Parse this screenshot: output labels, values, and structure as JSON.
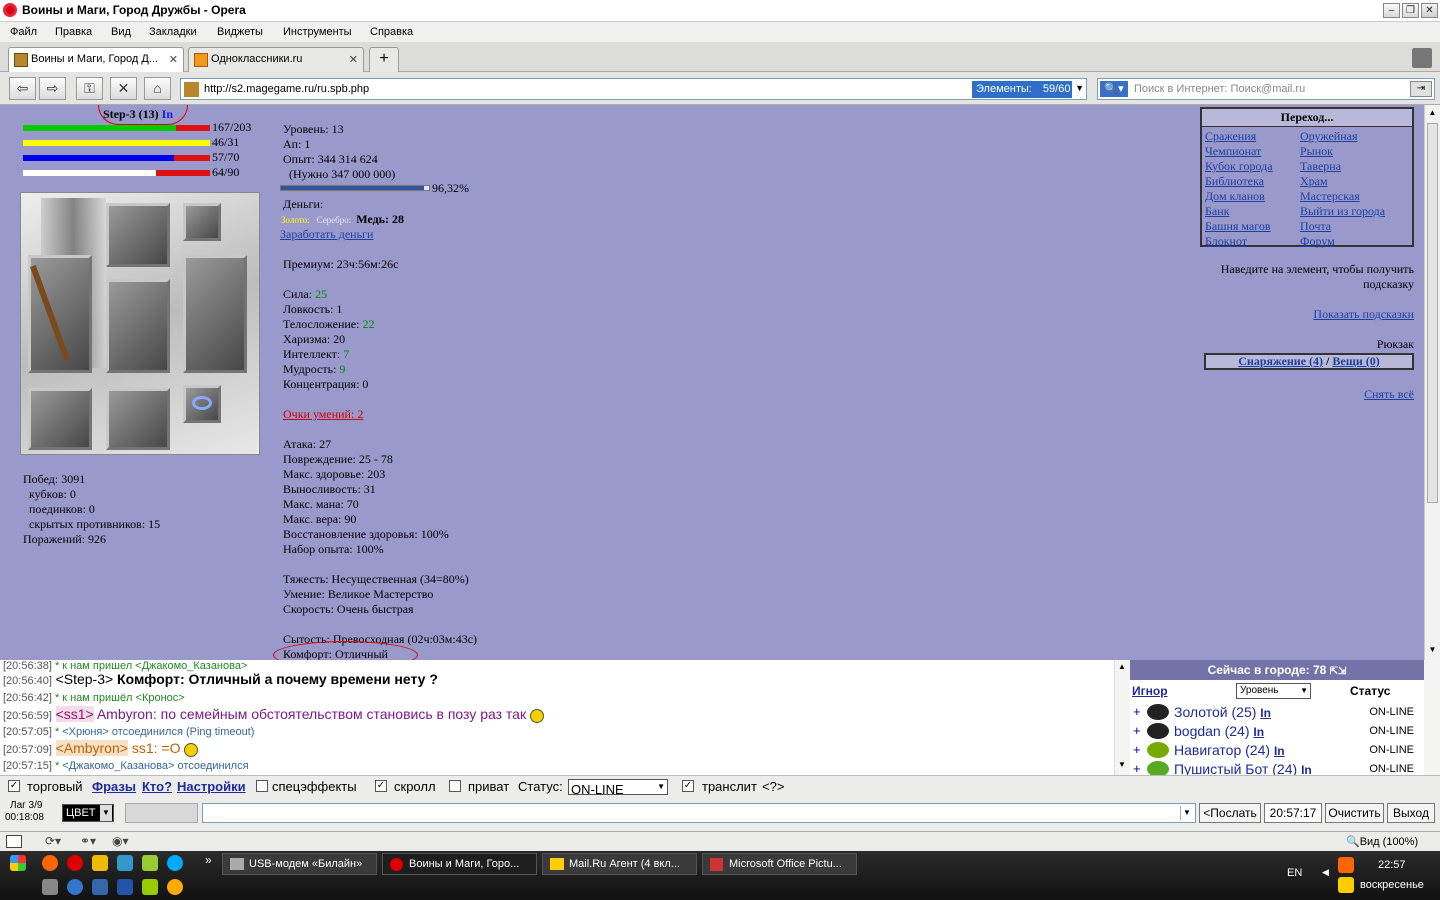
{
  "window": {
    "title": "Воины и Маги, Город Дружбы - Opera"
  },
  "menu": [
    "Файл",
    "Правка",
    "Вид",
    "Закладки",
    "Виджеты",
    "Инструменты",
    "Справка"
  ],
  "tabs": [
    {
      "label": "Воины и Маги, Город Д...",
      "close": "✕"
    },
    {
      "label": "Одноклассники.ru",
      "close": "✕"
    }
  ],
  "address": {
    "url": "http://s2.magegame.ru/ru.spb.php",
    "elements_label": "Элементы:",
    "elements_value": "59/60"
  },
  "search": {
    "placeholder": "Поиск в Интернет: Поиск@mail.ru"
  },
  "character": {
    "name": "Step-3 (13)",
    "ln": "In",
    "bars": [
      {
        "label": "167/203",
        "color": "#00cc00",
        "fraction": 0.82
      },
      {
        "label": "46/31",
        "color": "#ffff00",
        "fraction": 1.0
      },
      {
        "label": "57/70",
        "color": "#0000ee",
        "fraction": 0.81
      },
      {
        "label": "64/90",
        "color": "#ffffff",
        "fraction": 0.71
      }
    ]
  },
  "victories": {
    "lines": [
      "Побед: 3091",
      "кубков: 0",
      "поединков: 0",
      "скрытых противников: 15",
      "Поражений: 926"
    ]
  },
  "stats": {
    "level": "Уровень: 13",
    "ap": "Ап: 1",
    "exp": "Опыт: 344 314 624",
    "exp_need": "(Нужно 347 000 000)",
    "exp_percent": "96,32%",
    "exp_fraction": 0.9632,
    "money_label": "Деньги:",
    "gold": "Золото:",
    "silver": "Серебро:",
    "copper": "Медь: 28",
    "earn": "Заработать деньги",
    "premium": "Премиум: 23ч:56м:26с",
    "attrs": [
      {
        "k": "Сила: ",
        "v": "25",
        "green": true
      },
      {
        "k": "Ловкость: ",
        "v": "1",
        "green": false
      },
      {
        "k": "Телосложение: ",
        "v": "22",
        "green": true
      },
      {
        "k": "Харизма: ",
        "v": "20",
        "green": false
      },
      {
        "k": "Интеллект: ",
        "v": "7",
        "green": true
      },
      {
        "k": "Мудрость: ",
        "v": "9",
        "green": true
      },
      {
        "k": "Концентрация: ",
        "v": "0",
        "green": false
      }
    ],
    "skill_points": "Очки умений: 2",
    "combat": [
      "Атака: 27",
      "Повреждение: 25 - 78",
      "Макс. здоровье: 203",
      "Выносливость: 31",
      "Макс. мана: 70",
      "Макс. вера: 90",
      "Восстановление здоровья: 100%",
      "Набор опыта: 100%"
    ],
    "misc": [
      "Тяжесть: Несущественная (34=80%)",
      "Умение: Великое Мастерство",
      "Скорость: Очень быстрая"
    ],
    "satiety": "Сытость: Превосходная (02ч:03м:43с)",
    "comfort": "Комфорт: Отличный"
  },
  "navigation": {
    "header": "Переход...",
    "left": [
      "Сражения",
      "Чемпионат",
      "Кубок города",
      "Библиотека",
      "Дом кланов",
      "Банк",
      "Башня магов",
      "Блокнот"
    ],
    "right": [
      "Оружейная",
      "Рынок",
      "Таверна",
      "Храм",
      "Мастерская",
      "Выйти из города",
      "Почта",
      "Форум"
    ]
  },
  "hint": "Наведите на элемент, чтобы получить подсказку",
  "show_hints": "Показать подсказки",
  "backpack": {
    "label": "Рюкзак",
    "gear": "Снаряжение (4)",
    "sep": " / ",
    "items": "Вещи (0)",
    "remove_all": "Снять всё"
  },
  "chat": [
    {
      "time": "[20:56:38]",
      "text": "к нам пришел <Джакомо_Казанова>",
      "kind": "sys"
    },
    {
      "time": "[20:56:40]",
      "nick": "<Step-3>",
      "text": " Комфорт: Отличный а почему времени нету ?",
      "kind": "bold"
    },
    {
      "time": "[20:56:42]",
      "text": "к нам пришёл <Кронос>",
      "kind": "sys"
    },
    {
      "time": "[20:56:59]",
      "nick": "<ss1>",
      "text": " Ambyron: по семейным обстоятельством становись в позу раз так",
      "kind": "purple"
    },
    {
      "time": "[20:57:05]",
      "text": "<Хрюня> отсоединился (Ping timeout)",
      "kind": "sys2"
    },
    {
      "time": "[20:57:09]",
      "nick": "<Ambyron>",
      "text": " ss1: =O",
      "kind": "orange"
    },
    {
      "time": "[20:57:15]",
      "text": "<Джакомо_Казанова> отсоединился",
      "kind": "sys2"
    }
  ],
  "online": {
    "header": "Сейчас в городе: 78",
    "ignore": "Игнор",
    "sort": "Уровень",
    "status_col": "Статус",
    "rows": [
      {
        "name": "Золотой (25)",
        "ln": "In",
        "status": "ON-LINE"
      },
      {
        "name": "bogdan (24)",
        "ln": "In",
        "status": "ON-LINE"
      },
      {
        "name": "Навигатор (24)",
        "ln": "In",
        "status": "ON-LINE"
      },
      {
        "name": "Пушистый Бот (24)",
        "ln": "In",
        "status": "ON-LINE"
      }
    ]
  },
  "chat_controls": {
    "trade": "торговый",
    "phrases": "Фразы",
    "who": "Кто?",
    "settings": "Настройки",
    "effects": "спецэффекты",
    "scroll": "скролл",
    "private": "приват",
    "status_label": "Статус:",
    "status_value": "ON-LINE",
    "translit": "транслит",
    "translit_help": "<?>",
    "lag": "Лаг 3/9",
    "timer": "00:18:08",
    "color_label": "ЦВЕТ",
    "send": "<Послать",
    "clock": "20:57:17",
    "clear": "Очистить",
    "exit": "Выход"
  },
  "statusbar": {
    "zoom": "Вид (100%)"
  },
  "taskbar": {
    "tasks": [
      "USB-модем «Билайн»",
      "Воины и Маги, Горо...",
      "Mail.Ru Агент (4 вкл...",
      "Microsoft Office Pictu..."
    ],
    "lang": "EN",
    "time": "22:57",
    "day": "воскресенье"
  }
}
